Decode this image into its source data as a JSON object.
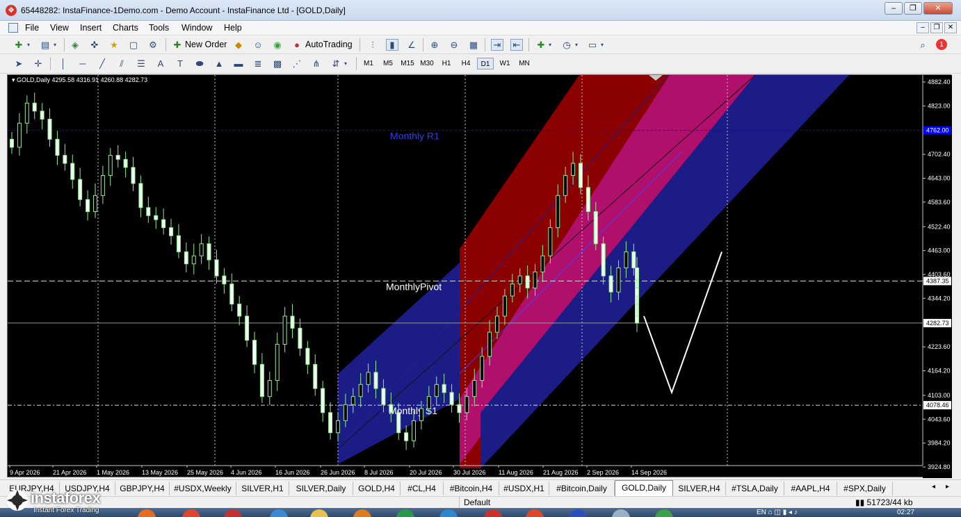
{
  "window": {
    "title": "65448282: InstaFinance-1Demo.com - Demo Account - InstaFinance Ltd - [GOLD,Daily]",
    "minimize": "–",
    "restore": "❐",
    "close": "✕"
  },
  "menu": {
    "items": [
      "File",
      "View",
      "Insert",
      "Charts",
      "Tools",
      "Window",
      "Help"
    ]
  },
  "toolbar": {
    "new_order": "New Order",
    "autotrading": "AutoTrading",
    "timeframes": [
      "M1",
      "M5",
      "M15",
      "M30",
      "H1",
      "H4",
      "D1",
      "W1",
      "MN"
    ],
    "active_timeframe": "D1",
    "notification_count": "1"
  },
  "chart": {
    "symbol_info": "GOLD,Daily  4295.58 4316.91 4260.88 4282.73",
    "levels": {
      "r1_label": "Monthly R1",
      "pivot_label": "MonthlyPivot",
      "s1_label": "Monthly S1",
      "r1_value": "4762.00",
      "pivot_value": "4387.35",
      "s1_value": "4078.46",
      "current_price": "4282.73"
    },
    "colors": {
      "background": "#000000",
      "candle": "#90ee90",
      "r1_line": "#0000ff",
      "channel_outer": "#8b0000",
      "channel_mid": "#b0106b",
      "channel_inner": "#1c1c86"
    }
  },
  "chart_data": {
    "type": "candlestick",
    "symbol": "GOLD",
    "timeframe": "Daily",
    "ohlc_last": {
      "open": 4295.58,
      "high": 4316.91,
      "low": 4260.88,
      "close": 4282.73
    },
    "y_ticks": [
      "4882.40",
      "4823.00",
      "4702.40",
      "4643.00",
      "4583.60",
      "4522.40",
      "4463.00",
      "4403.60",
      "4344.20",
      "4223.60",
      "4164.20",
      "4103.00",
      "4043.60",
      "3984.20",
      "3924.80"
    ],
    "ylim": [
      3924.8,
      4882.4
    ],
    "x_ticks": [
      "9 Apr 2026",
      "21 Apr 2026",
      "1 May 2026",
      "13 May 2026",
      "25 May 2026",
      "4 Jun 2026",
      "16 Jun 2026",
      "26 Jun 2026",
      "8 Jul 2026",
      "20 Jul 2026",
      "30 Jul 2026",
      "11 Aug 2026",
      "21 Aug 2026",
      "2 Sep 2026",
      "14 Sep 2026"
    ],
    "closes": [
      4720,
      4780,
      4830,
      4810,
      4790,
      4740,
      4700,
      4680,
      4640,
      4590,
      4560,
      4600,
      4650,
      4700,
      4690,
      4670,
      4630,
      4570,
      4550,
      4540,
      4520,
      4500,
      4460,
      4430,
      4450,
      4480,
      4440,
      4400,
      4380,
      4330,
      4300,
      4240,
      4180,
      4100,
      4140,
      4230,
      4300,
      4270,
      4220,
      4180,
      4120,
      4060,
      4010,
      4040,
      4080,
      4100,
      4130,
      4160,
      4120,
      4080,
      4060,
      4010,
      3990,
      4040,
      4070,
      4100,
      4130,
      4110,
      4080,
      4060,
      4100,
      4140,
      4200,
      4260,
      4300,
      4350,
      4380,
      4400,
      4370,
      4410,
      4450,
      4520,
      4600,
      4650,
      4680,
      4620,
      4560,
      4480,
      4400,
      4360,
      4420,
      4460,
      4420,
      4390,
      4370,
      4330,
      4300,
      4282.73
    ],
    "levels": [
      {
        "name": "Monthly R1",
        "value": 4762.0
      },
      {
        "name": "MonthlyPivot",
        "value": 4387.35
      },
      {
        "name": "Monthly S1",
        "value": 4078.46
      }
    ],
    "current_price": 4282.73,
    "forecast_path": [
      4300,
      4110,
      4460
    ]
  },
  "tabs": {
    "items": [
      "EURJPY,H4",
      "USDJPY,H4",
      "GBPJPY,H4",
      "#USDX,Weekly",
      "SILVER,H1",
      "SILVER,Daily",
      "GOLD,H4",
      "#CL,H4",
      "#Bitcoin,H4",
      "#USDX,H1",
      "#Bitcoin,Daily",
      "GOLD,Daily",
      "SILVER,H4",
      "#TSLA,Daily",
      "#AAPL,H4",
      "#SPX,Daily"
    ],
    "active": "GOLD,Daily"
  },
  "status": {
    "profile": "Default",
    "traffic": "51723/44 kb"
  },
  "logo": {
    "name": "instaforex",
    "tagline": "Instant Forex Trading"
  },
  "taskbar": {
    "lang": "EN",
    "time": "02:27"
  }
}
